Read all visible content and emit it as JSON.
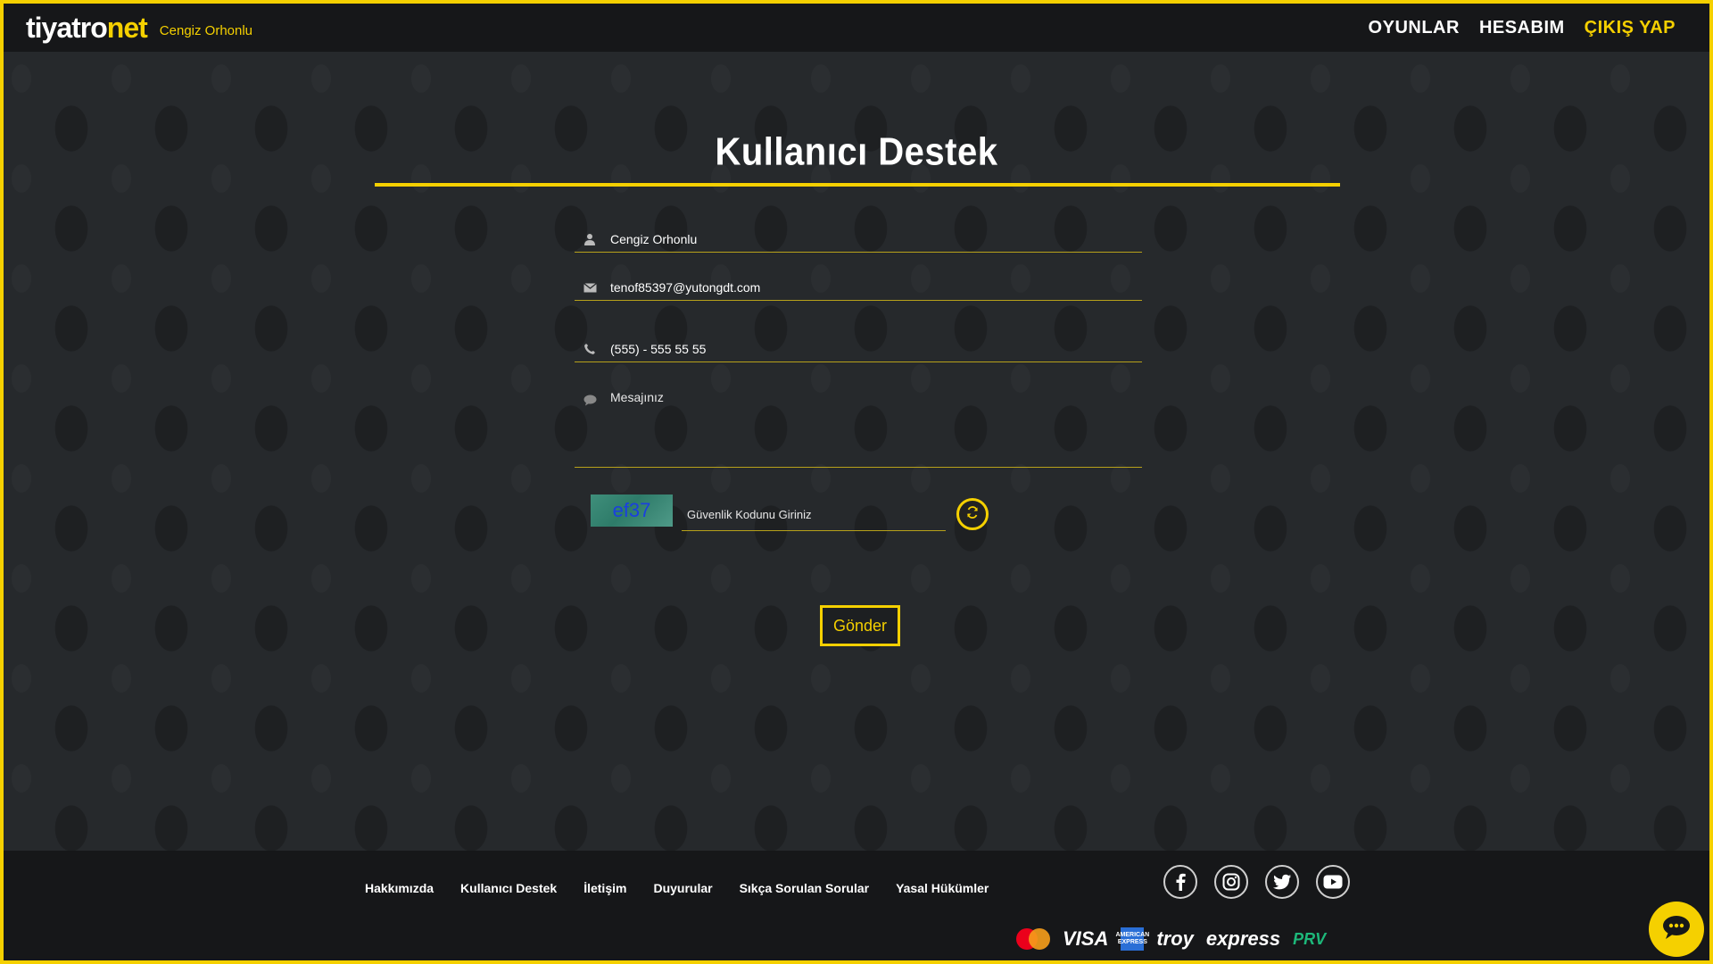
{
  "header": {
    "logo_white": "tiyatro",
    "logo_yellow": "net",
    "user_name": "Cengiz Orhonlu",
    "nav": [
      "OYUNLAR",
      "HESABIM",
      "ÇIKIŞ YAP"
    ]
  },
  "form": {
    "title": "Kullanıcı Destek",
    "name_value": "Cengiz Orhonlu",
    "email_value": "tenof85397@yutongdt.com",
    "phone_value": "(555) - 555 55 55",
    "message_placeholder": "Mesajınız",
    "captcha_code": "ef37",
    "captcha_placeholder": "Güvenlik Kodunu Giriniz",
    "submit_label": "Gönder"
  },
  "footer": {
    "links": [
      "Hakkımızda",
      "Kullanıcı Destek",
      "İletişim",
      "Duyurular",
      "Sıkça Sorulan Sorular",
      "Yasal Hükümler"
    ],
    "social": [
      "facebook-icon",
      "instagram-icon",
      "twitter-icon",
      "youtube-icon"
    ],
    "payments": {
      "mastercard": "mastercard",
      "visa": "VISA",
      "amex": "AMERICAN EXPRESS",
      "troy": "troy",
      "express": "express",
      "paypass": "PRV"
    }
  },
  "colors": {
    "accent": "#f5d000",
    "background": "#25282b",
    "header": "#161719"
  }
}
